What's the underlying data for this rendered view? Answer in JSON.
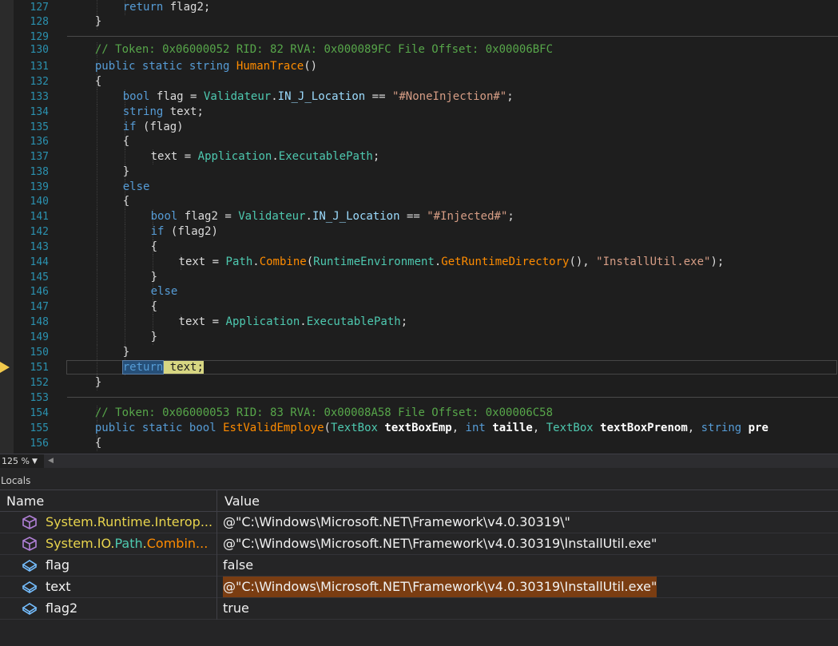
{
  "editor": {
    "lines": [
      {
        "num": "127",
        "indent": 3,
        "tokens": [
          {
            "t": "return",
            "c": "kw"
          },
          {
            "t": " flag2;",
            "c": "pl"
          }
        ]
      },
      {
        "num": "128",
        "indent": 2,
        "tokens": [
          {
            "t": "}",
            "c": "pl"
          }
        ]
      },
      {
        "num": "129",
        "indent": 0,
        "tokens": [],
        "sep": true
      },
      {
        "num": "130",
        "indent": 2,
        "tokens": [
          {
            "t": "// Token: 0x06000052 RID: 82 RVA: 0x000089FC File Offset: 0x00006BFC",
            "c": "cm"
          }
        ]
      },
      {
        "num": "131",
        "indent": 2,
        "tokens": [
          {
            "t": "public",
            "c": "kw"
          },
          {
            "t": " ",
            "c": "pl"
          },
          {
            "t": "static",
            "c": "kw"
          },
          {
            "t": " ",
            "c": "pl"
          },
          {
            "t": "string",
            "c": "kw"
          },
          {
            "t": " ",
            "c": "pl"
          },
          {
            "t": "HumanTrace",
            "c": "me"
          },
          {
            "t": "()",
            "c": "pl"
          }
        ]
      },
      {
        "num": "132",
        "indent": 2,
        "tokens": [
          {
            "t": "{",
            "c": "pl"
          }
        ]
      },
      {
        "num": "133",
        "indent": 3,
        "tokens": [
          {
            "t": "bool",
            "c": "kw"
          },
          {
            "t": " flag = ",
            "c": "pl"
          },
          {
            "t": "Validateur",
            "c": "ty"
          },
          {
            "t": ".",
            "c": "pl"
          },
          {
            "t": "IN_J_Location",
            "c": "fl"
          },
          {
            "t": " == ",
            "c": "pl"
          },
          {
            "t": "\"#NoneInjection#\"",
            "c": "str"
          },
          {
            "t": ";",
            "c": "pl"
          }
        ]
      },
      {
        "num": "134",
        "indent": 3,
        "tokens": [
          {
            "t": "string",
            "c": "kw"
          },
          {
            "t": " text;",
            "c": "pl"
          }
        ]
      },
      {
        "num": "135",
        "indent": 3,
        "tokens": [
          {
            "t": "if",
            "c": "kw"
          },
          {
            "t": " (flag)",
            "c": "pl"
          }
        ]
      },
      {
        "num": "136",
        "indent": 3,
        "tokens": [
          {
            "t": "{",
            "c": "pl"
          }
        ]
      },
      {
        "num": "137",
        "indent": 4,
        "tokens": [
          {
            "t": "text = ",
            "c": "pl"
          },
          {
            "t": "Application",
            "c": "ty"
          },
          {
            "t": ".",
            "c": "pl"
          },
          {
            "t": "ExecutablePath",
            "c": "ty"
          },
          {
            "t": ";",
            "c": "pl"
          }
        ]
      },
      {
        "num": "138",
        "indent": 3,
        "tokens": [
          {
            "t": "}",
            "c": "pl"
          }
        ]
      },
      {
        "num": "139",
        "indent": 3,
        "tokens": [
          {
            "t": "else",
            "c": "kw"
          }
        ]
      },
      {
        "num": "140",
        "indent": 3,
        "tokens": [
          {
            "t": "{",
            "c": "pl"
          }
        ]
      },
      {
        "num": "141",
        "indent": 4,
        "tokens": [
          {
            "t": "bool",
            "c": "kw"
          },
          {
            "t": " flag2 = ",
            "c": "pl"
          },
          {
            "t": "Validateur",
            "c": "ty"
          },
          {
            "t": ".",
            "c": "pl"
          },
          {
            "t": "IN_J_Location",
            "c": "fl"
          },
          {
            "t": " == ",
            "c": "pl"
          },
          {
            "t": "\"#Injected#\"",
            "c": "str"
          },
          {
            "t": ";",
            "c": "pl"
          }
        ]
      },
      {
        "num": "142",
        "indent": 4,
        "tokens": [
          {
            "t": "if",
            "c": "kw"
          },
          {
            "t": " (flag2)",
            "c": "pl"
          }
        ]
      },
      {
        "num": "143",
        "indent": 4,
        "tokens": [
          {
            "t": "{",
            "c": "pl"
          }
        ]
      },
      {
        "num": "144",
        "indent": 5,
        "tokens": [
          {
            "t": "text = ",
            "c": "pl"
          },
          {
            "t": "Path",
            "c": "ty"
          },
          {
            "t": ".",
            "c": "pl"
          },
          {
            "t": "Combine",
            "c": "me"
          },
          {
            "t": "(",
            "c": "pl"
          },
          {
            "t": "RuntimeEnvironment",
            "c": "ty"
          },
          {
            "t": ".",
            "c": "pl"
          },
          {
            "t": "GetRuntimeDirectory",
            "c": "me"
          },
          {
            "t": "(), ",
            "c": "pl"
          },
          {
            "t": "\"InstallUtil.exe\"",
            "c": "str"
          },
          {
            "t": ");",
            "c": "pl"
          }
        ]
      },
      {
        "num": "145",
        "indent": 4,
        "tokens": [
          {
            "t": "}",
            "c": "pl"
          }
        ]
      },
      {
        "num": "146",
        "indent": 4,
        "tokens": [
          {
            "t": "else",
            "c": "kw"
          }
        ]
      },
      {
        "num": "147",
        "indent": 4,
        "tokens": [
          {
            "t": "{",
            "c": "pl"
          }
        ]
      },
      {
        "num": "148",
        "indent": 5,
        "tokens": [
          {
            "t": "text = ",
            "c": "pl"
          },
          {
            "t": "Application",
            "c": "ty"
          },
          {
            "t": ".",
            "c": "pl"
          },
          {
            "t": "ExecutablePath",
            "c": "ty"
          },
          {
            "t": ";",
            "c": "pl"
          }
        ]
      },
      {
        "num": "149",
        "indent": 4,
        "tokens": [
          {
            "t": "}",
            "c": "pl"
          }
        ]
      },
      {
        "num": "150",
        "indent": 3,
        "tokens": [
          {
            "t": "}",
            "c": "pl"
          }
        ]
      },
      {
        "num": "151",
        "indent": 3,
        "current": true,
        "tokens": [
          {
            "t": "return",
            "c": "kw hl-ret"
          },
          {
            "t": " text;",
            "c": "hl-txt"
          }
        ]
      },
      {
        "num": "152",
        "indent": 2,
        "tokens": [
          {
            "t": "}",
            "c": "pl"
          }
        ]
      },
      {
        "num": "153",
        "indent": 0,
        "tokens": [],
        "sep": true
      },
      {
        "num": "154",
        "indent": 2,
        "tokens": [
          {
            "t": "// Token: 0x06000053 RID: 83 RVA: 0x00008A58 File Offset: 0x00006C58",
            "c": "cm"
          }
        ]
      },
      {
        "num": "155",
        "indent": 2,
        "tokens": [
          {
            "t": "public",
            "c": "kw"
          },
          {
            "t": " ",
            "c": "pl"
          },
          {
            "t": "static",
            "c": "kw"
          },
          {
            "t": " ",
            "c": "pl"
          },
          {
            "t": "bool",
            "c": "kw"
          },
          {
            "t": " ",
            "c": "pl"
          },
          {
            "t": "EstValidEmploye",
            "c": "me"
          },
          {
            "t": "(",
            "c": "pl"
          },
          {
            "t": "TextBox",
            "c": "ty"
          },
          {
            "t": " ",
            "c": "pl"
          },
          {
            "t": "textBoxEmp",
            "c": "pa"
          },
          {
            "t": ", ",
            "c": "pl"
          },
          {
            "t": "int",
            "c": "kw"
          },
          {
            "t": " ",
            "c": "pl"
          },
          {
            "t": "taille",
            "c": "pa"
          },
          {
            "t": ", ",
            "c": "pl"
          },
          {
            "t": "TextBox",
            "c": "ty"
          },
          {
            "t": " ",
            "c": "pl"
          },
          {
            "t": "textBoxPrenom",
            "c": "pa"
          },
          {
            "t": ", ",
            "c": "pl"
          },
          {
            "t": "string",
            "c": "kw"
          },
          {
            "t": " ",
            "c": "pl"
          },
          {
            "t": "pre",
            "c": "pa"
          }
        ]
      },
      {
        "num": "156",
        "indent": 2,
        "tokens": [
          {
            "t": "{",
            "c": "pl"
          }
        ]
      }
    ]
  },
  "zoom": {
    "level": "125 %"
  },
  "locals": {
    "title": "Locals",
    "columns": {
      "name": "Name",
      "value": "Value"
    },
    "rows": [
      {
        "icon": "method-return-icon",
        "name_parts": [
          {
            "t": "System.Runtime.Interop...",
            "c": "yellow"
          }
        ],
        "value": "@\"C:\\Windows\\Microsoft.NET\\Framework\\v4.0.30319\\\"",
        "vclass": ""
      },
      {
        "icon": "method-return-icon",
        "name_parts": [
          {
            "t": "System.IO.",
            "c": "yellow"
          },
          {
            "t": "Path",
            "c": "teal"
          },
          {
            "t": ".",
            "c": "yellow"
          },
          {
            "t": "Combin...",
            "c": "orange"
          }
        ],
        "value": "@\"C:\\Windows\\Microsoft.NET\\Framework\\v4.0.30319\\InstallUtil.exe\"",
        "vclass": ""
      },
      {
        "icon": "local-variable-icon",
        "name_parts": [
          {
            "t": "flag",
            "c": "plain"
          }
        ],
        "value": "false",
        "vclass": "bool"
      },
      {
        "icon": "local-variable-icon",
        "name_parts": [
          {
            "t": "text",
            "c": "plain"
          }
        ],
        "value": "@\"C:\\Windows\\Microsoft.NET\\Framework\\v4.0.30319\\InstallUtil.exe\"",
        "vclass": "hl"
      },
      {
        "icon": "local-variable-icon",
        "name_parts": [
          {
            "t": "flag2",
            "c": "plain"
          }
        ],
        "value": "true",
        "vclass": "bool"
      }
    ]
  }
}
